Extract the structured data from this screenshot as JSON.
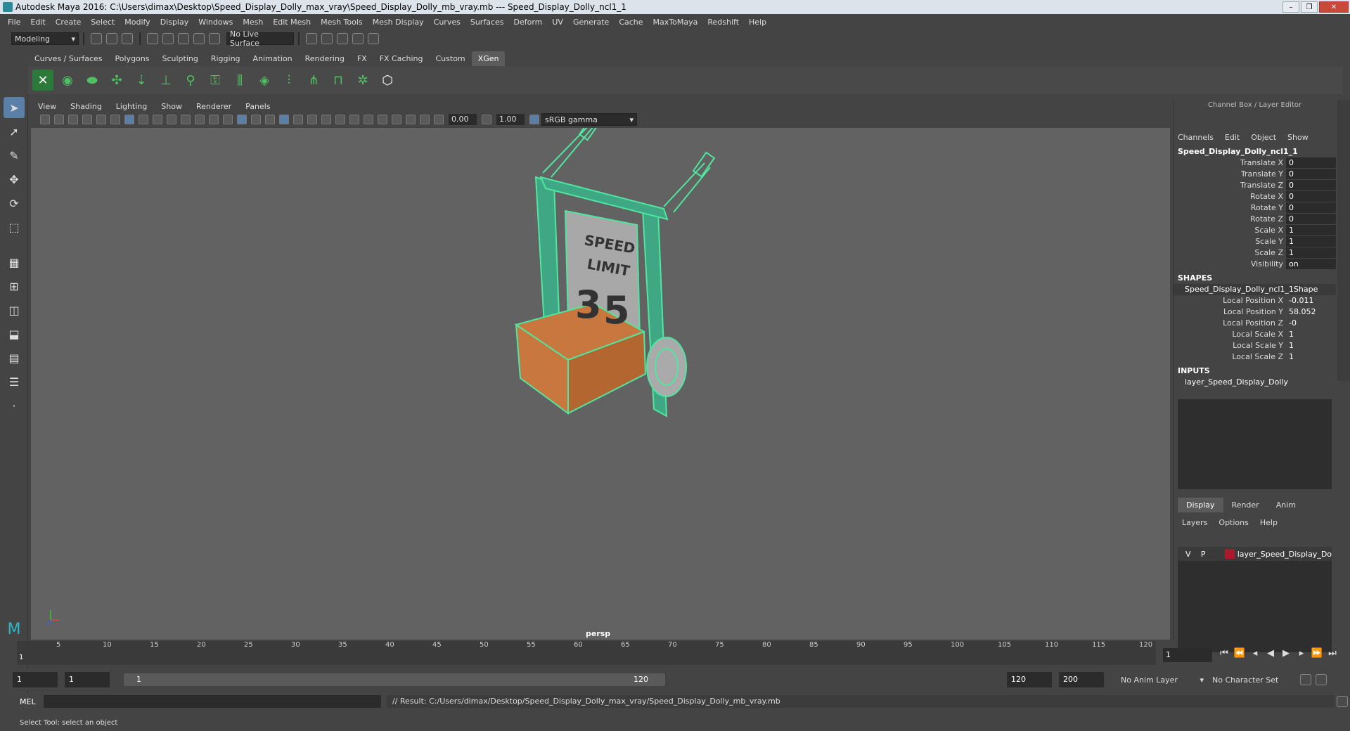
{
  "titlebar": {
    "title": "Autodesk Maya 2016: C:\\Users\\dimax\\Desktop\\Speed_Display_Dolly_max_vray\\Speed_Display_Dolly_mb_vray.mb   ---   Speed_Display_Dolly_ncl1_1",
    "min": "–",
    "max": "❐",
    "close": "✕"
  },
  "menubar": [
    "File",
    "Edit",
    "Create",
    "Select",
    "Modify",
    "Display",
    "Windows",
    "Mesh",
    "Edit Mesh",
    "Mesh Tools",
    "Mesh Display",
    "Curves",
    "Surfaces",
    "Deform",
    "UV",
    "Generate",
    "Cache",
    "MaxToMaya",
    "Redshift",
    "Help"
  ],
  "statusline": {
    "mode": "Modeling",
    "live_surface": "No Live Surface"
  },
  "shelf_tabs": [
    "Curves / Surfaces",
    "Polygons",
    "Sculpting",
    "Rigging",
    "Animation",
    "Rendering",
    "FX",
    "FX Caching",
    "Custom",
    "XGen"
  ],
  "shelf_active": "XGen",
  "viewport": {
    "menu": [
      "View",
      "Shading",
      "Lighting",
      "Show",
      "Renderer",
      "Panels"
    ],
    "exposure": "0.00",
    "gamma": "1.00",
    "color_space": "sRGB gamma",
    "camera": "persp",
    "sign_text_1": "SPEED",
    "sign_text_2": "LIMIT",
    "sign_digit_1": "3",
    "sign_digit_2": "5"
  },
  "channel_box": {
    "title": "Channel Box / Layer Editor",
    "menu": [
      "Channels",
      "Edit",
      "Object",
      "Show"
    ],
    "object": "Speed_Display_Dolly_ncl1_1",
    "attrs": [
      {
        "name": "Translate X",
        "value": "0"
      },
      {
        "name": "Translate Y",
        "value": "0"
      },
      {
        "name": "Translate Z",
        "value": "0"
      },
      {
        "name": "Rotate X",
        "value": "0"
      },
      {
        "name": "Rotate Y",
        "value": "0"
      },
      {
        "name": "Rotate Z",
        "value": "0"
      },
      {
        "name": "Scale X",
        "value": "1"
      },
      {
        "name": "Scale Y",
        "value": "1"
      },
      {
        "name": "Scale Z",
        "value": "1"
      },
      {
        "name": "Visibility",
        "value": "on"
      }
    ],
    "shapes_label": "SHAPES",
    "shape_name": "Speed_Display_Dolly_ncl1_1Shape",
    "shape_attrs": [
      {
        "name": "Local Position X",
        "value": "-0.011"
      },
      {
        "name": "Local Position Y",
        "value": "58.052"
      },
      {
        "name": "Local Position Z",
        "value": "-0"
      },
      {
        "name": "Local Scale X",
        "value": "1"
      },
      {
        "name": "Local Scale Y",
        "value": "1"
      },
      {
        "name": "Local Scale Z",
        "value": "1"
      }
    ],
    "inputs_label": "INPUTS",
    "input_name": "layer_Speed_Display_Dolly"
  },
  "layer_editor": {
    "tabs": [
      "Display",
      "Render",
      "Anim"
    ],
    "active_tab": "Display",
    "menu": [
      "Layers",
      "Options",
      "Help"
    ],
    "layer": {
      "v": "V",
      "p": "P",
      "name": "layer_Speed_Display_Dol",
      "color": "#a81a2c"
    }
  },
  "timeline": {
    "ticks": [
      "5",
      "10",
      "15",
      "20",
      "25",
      "30",
      "35",
      "40",
      "45",
      "50",
      "55",
      "60",
      "65",
      "70",
      "75",
      "80",
      "85",
      "90",
      "95",
      "100",
      "105",
      "110",
      "115",
      "120"
    ],
    "start_label": "1",
    "current_frame": "1"
  },
  "range": {
    "start": "1",
    "playback_start": "1",
    "slider_start": "1",
    "slider_end": "120",
    "playback_end": "120",
    "end": "200",
    "anim_layer": "No Anim Layer",
    "char_set": "No Character Set"
  },
  "cmdline": {
    "lang": "MEL",
    "result": "// Result: C:/Users/dimax/Desktop/Speed_Display_Dolly_max_vray/Speed_Display_Dolly_mb_vray.mb"
  },
  "helpline": "Select Tool: select an object",
  "colors": {
    "wire": "#4fe6a0",
    "box": "#c8783e",
    "accent": "#5b80a8"
  }
}
